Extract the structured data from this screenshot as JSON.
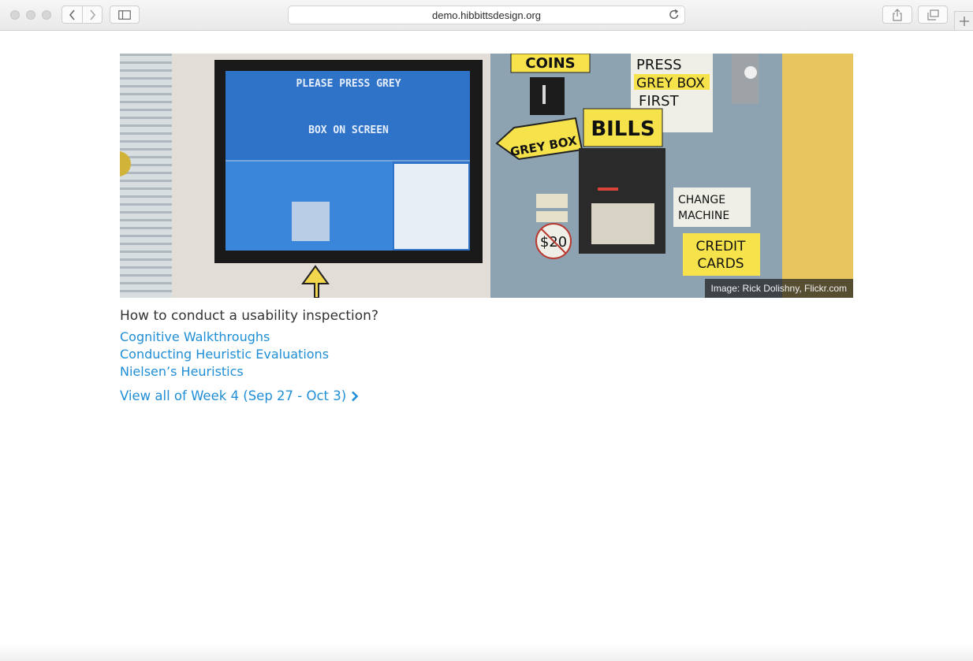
{
  "browser": {
    "url": "demo.hibbittsdesign.org",
    "icons": {
      "back": "chevron-left-icon",
      "forward": "chevron-right-icon",
      "sidebar": "sidebar-icon",
      "reload": "reload-icon",
      "share": "share-icon",
      "tabs": "tabs-overview-icon",
      "new_tab": "plus-icon"
    }
  },
  "hero": {
    "caption": "Image: Rick Dolishny, Flickr.com",
    "screen_line1": "PLEASE PRESS GREY",
    "screen_line2": "BOX ON SCREEN",
    "sign_coins": "COINS",
    "sign_press": "PRESS",
    "sign_greybox": "GREY BOX",
    "sign_first": "FIRST",
    "sign_bills": "BILLS",
    "sign_greybox_arrow": "GREY BOX",
    "sign_change": "CHANGE",
    "sign_machine": "MACHINE",
    "sign_credit": "CREDIT",
    "sign_cards": "CARDS",
    "sign_twenty": "$20"
  },
  "content": {
    "question": "How to conduct a usability inspection?",
    "links": [
      "Cognitive Walkthroughs",
      "Conducting Heuristic Evaluations",
      "Nielsen’s Heuristics"
    ],
    "view_all": "View all of Week 4 (Sep 27 - Oct 3)",
    "link_color": "#1f8ed6"
  }
}
